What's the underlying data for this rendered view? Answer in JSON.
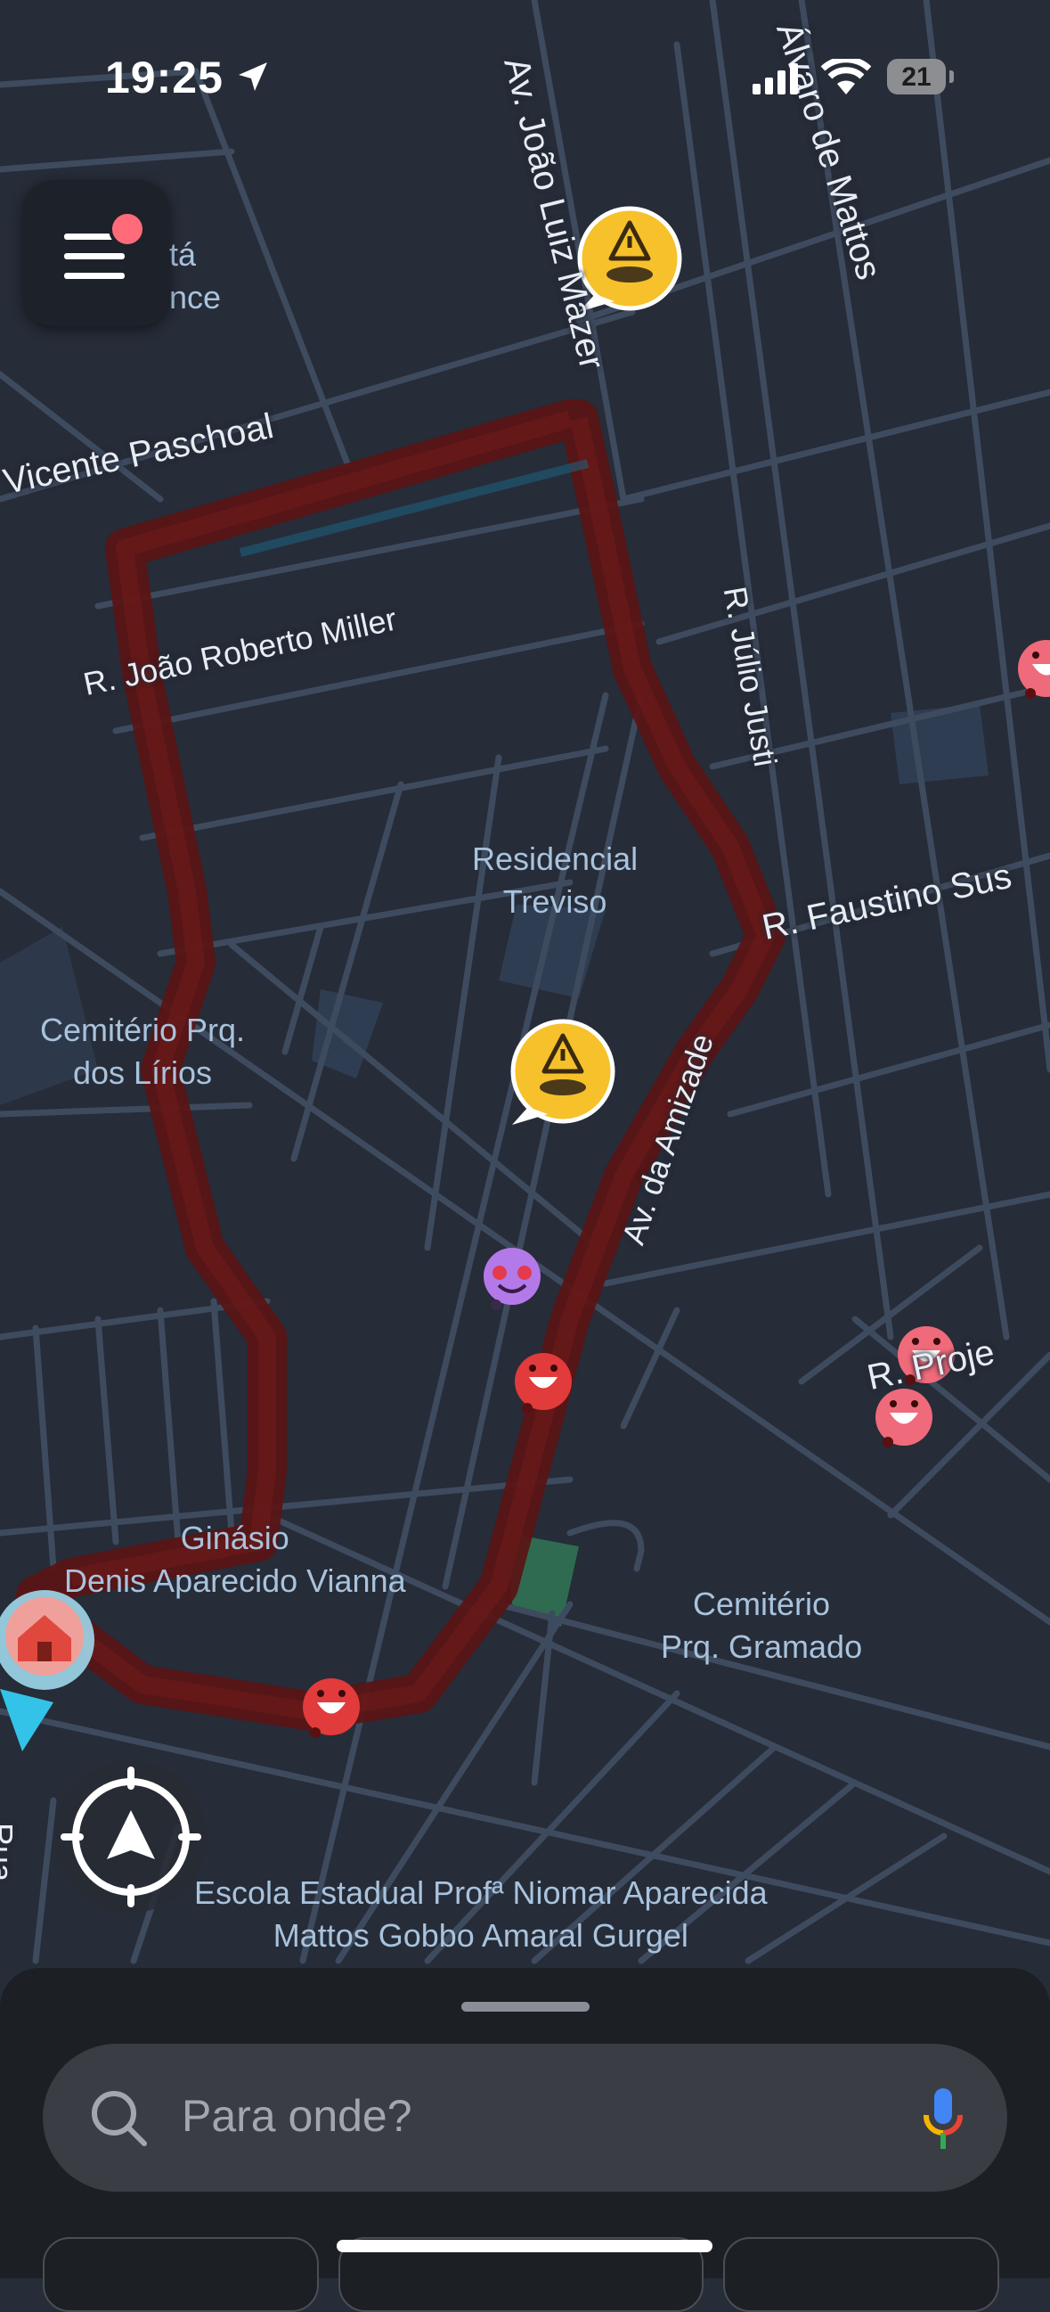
{
  "status_bar": {
    "time": "19:25",
    "battery_level": "21",
    "icons": [
      "location-arrow-icon",
      "cellular-signal-icon",
      "wifi-icon",
      "battery-icon"
    ]
  },
  "menu": {
    "icon": "hamburger-menu-icon",
    "has_notification_dot": true
  },
  "map": {
    "place_labels": {
      "residencial_treviso": "Residencial\nTreviso",
      "cemiterio_lirios": "Cemitério Prq.\ndos Lírios",
      "ginasio": "Ginásio\nDenis Aparecido Vianna",
      "cemiterio_gramado": "Cemitério\nPrq. Gramado",
      "escola": "Escola Estadual Profª Niomar Aparecida\nMattos Gobbo Amaral Gurgel",
      "partial_ita": "tá",
      "partial_ence": "nce"
    },
    "street_labels": {
      "vicente_paschoal": "Vicente Paschoal",
      "joao_roberto_miller": "R. João Roberto Miller",
      "joao_luiz_mazer": "Av. João Luiz Mazer",
      "alvaro_de_mattos": "Álvaro de Mattos",
      "julio_justi": "R. Júlio Justi",
      "faustino": "R. Faustino Sus",
      "amizade": "Av. da Amizade",
      "projeto": "R. Proje",
      "partial_left": "Rua"
    },
    "markers": [
      "hazard-pothole-icon",
      "hazard-pothole-icon",
      "love-wazer-icon",
      "happy-wazer-icon",
      "happy-wazer-icon",
      "happy-wazer-icon",
      "happy-wazer-icon",
      "happy-wazer-icon",
      "home-icon",
      "current-location-arrow-icon"
    ],
    "colors": {
      "background": "#262c38",
      "road": "#3e4b5e",
      "route": "#5a1414",
      "label": "#a9c3dd",
      "hazard": "#f6c12a",
      "wazer": "#e9546b"
    }
  },
  "recenter": {
    "icon": "recenter-compass-icon"
  },
  "bottom_sheet": {
    "search_placeholder": "Para onde?",
    "search_icon": "search-icon",
    "mic_icon": "microphone-icon"
  }
}
